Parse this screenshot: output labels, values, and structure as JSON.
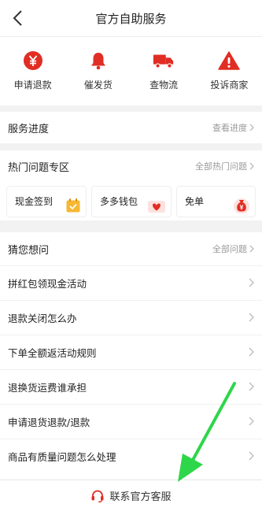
{
  "header": {
    "title": "官方自助服务",
    "back_icon": "back-chevron-icon"
  },
  "quick_actions": [
    {
      "label": "申请退款",
      "icon": "yen-coin-icon"
    },
    {
      "label": "催发货",
      "icon": "bell-icon"
    },
    {
      "label": "查物流",
      "icon": "truck-icon"
    },
    {
      "label": "投诉商家",
      "icon": "warning-icon"
    }
  ],
  "service_progress": {
    "label": "服务进度",
    "link": "查看进度"
  },
  "hot": {
    "label": "热门问题专区",
    "link": "全部热门问题",
    "cards": [
      {
        "label": "现金签到",
        "icon": "calendar-check-icon"
      },
      {
        "label": "多多钱包",
        "icon": "wallet-heart-icon"
      },
      {
        "label": "免单",
        "icon": "money-bag-icon"
      }
    ]
  },
  "guess": {
    "label": "猜您想问",
    "link": "全部问题",
    "items": [
      "拼红包领现金活动",
      "退款关闭怎么办",
      "下单全额返活动规则",
      "退换货运费谁承担",
      "申请退货退款/退款",
      "商品有质量问题怎么处理"
    ]
  },
  "footer": {
    "label": "联系官方客服",
    "icon": "headset-icon"
  },
  "colors": {
    "accent": "#e02e24",
    "annotation_arrow": "#2ed64a"
  }
}
